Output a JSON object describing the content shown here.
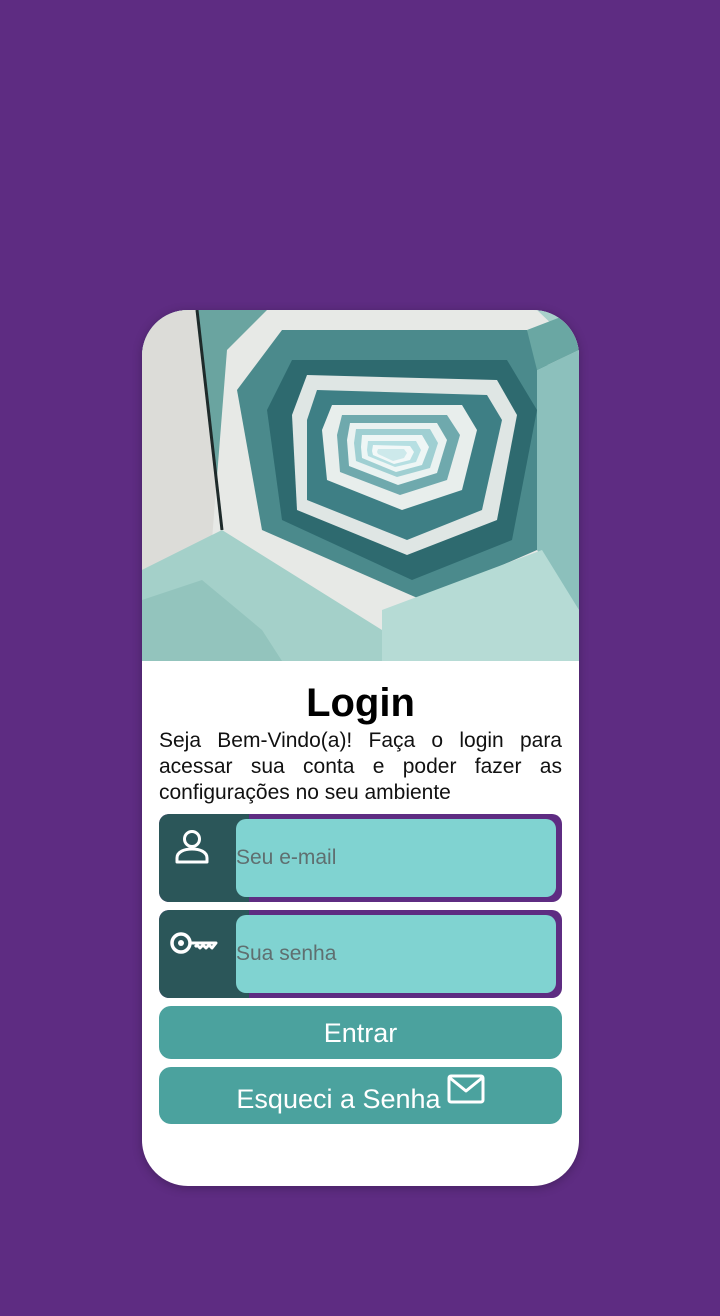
{
  "login": {
    "title": "Login",
    "subtitle": "Seja Bem-Vindo(a)! Faça o login para acessar sua conta e poder fazer as configurações no seu ambiente",
    "email_placeholder": "Seu e-mail",
    "password_placeholder": "Sua senha",
    "enter_label": "Entrar",
    "forgot_label": "Esqueci a Senha"
  },
  "icons": {
    "email_field": "user-icon",
    "password_field": "key-icon",
    "forgot_button": "mail-icon"
  },
  "colors": {
    "background": "#5e2c82",
    "card": "#ffffff",
    "icon_box": "#2b5659",
    "input": "#80d3d1",
    "button": "#4ba29e"
  }
}
